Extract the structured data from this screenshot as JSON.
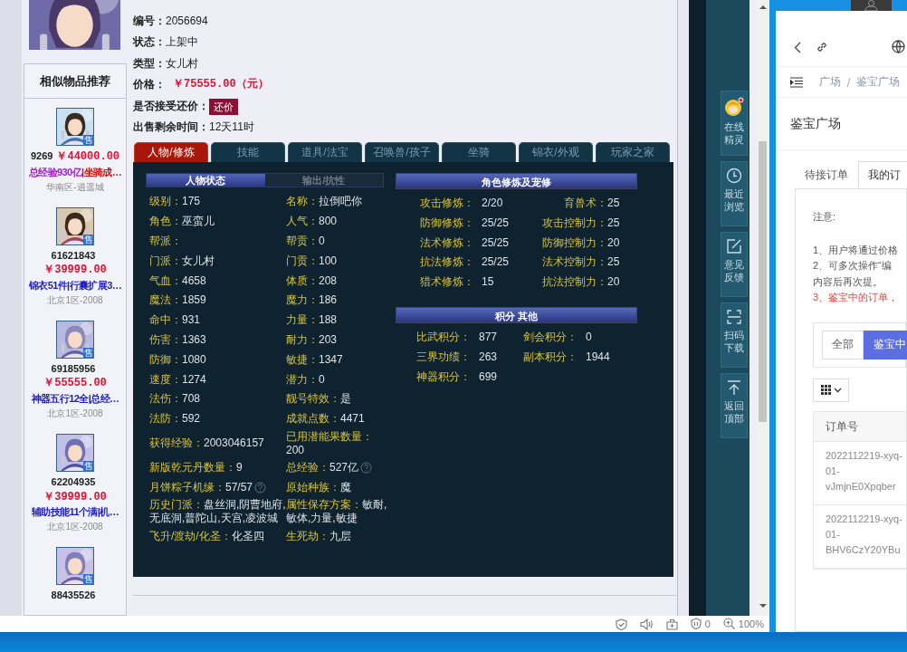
{
  "recommend": {
    "title": "相似物品推荐",
    "items": [
      {
        "badge": "售",
        "id": "9269",
        "price": "￥44000.00",
        "desc": [
          {
            "text": "总经验930亿",
            "color": "#a01ec8"
          },
          {
            "text": "|坐骑成…",
            "color": "#d01010"
          }
        ],
        "server": "华南区-逍遥城"
      },
      {
        "badge": "售",
        "id": "61621843",
        "price": "￥39999.00",
        "desc": [
          {
            "text": "锦衣51件|行囊扩展3…",
            "color": "#1e1ec8"
          }
        ],
        "server": "北京1区-2008"
      },
      {
        "badge": "售",
        "id": "69185956",
        "price": "￥55555.00",
        "desc": [
          {
            "text": "神器五行12全|总经…",
            "color": "#1e1ec8"
          }
        ],
        "server": "北京1区-2008"
      },
      {
        "badge": "售",
        "id": "62204935",
        "price": "￥39999.00",
        "desc": [
          {
            "text": "辅助技能11个满|机…",
            "color": "#1e1ec8"
          }
        ],
        "server": "北京1区-2008"
      },
      {
        "badge": "售",
        "id": "88435526"
      }
    ]
  },
  "listing": {
    "fields": [
      {
        "label": "编号：",
        "value": "2056694",
        "kind": "plain"
      },
      {
        "label": "状态：",
        "value": "上架中",
        "kind": "plain"
      },
      {
        "label": "类型：",
        "value": "女儿村",
        "kind": "plain"
      },
      {
        "label": "价格：",
        "value": "￥75555.00（元）",
        "kind": "price"
      },
      {
        "label": "是否接受还价：",
        "value": "还价",
        "kind": "button"
      },
      {
        "label": "出售剩余时间：",
        "value": "12天11时",
        "kind": "plain"
      }
    ]
  },
  "tabs": [
    {
      "label": "人物/修炼",
      "selected": true
    },
    {
      "label": "技能",
      "selected": false
    },
    {
      "label": "道具/法宝",
      "selected": false
    },
    {
      "label": "召唤兽/孩子",
      "selected": false
    },
    {
      "label": "坐骑",
      "selected": false
    },
    {
      "label": "锦衣/外观",
      "selected": false
    },
    {
      "label": "玩家之家",
      "selected": false
    }
  ],
  "status_panel": {
    "tabs": [
      {
        "label": "人物状态",
        "selected": true
      },
      {
        "label": "输出/抗性",
        "selected": false
      }
    ],
    "rows": [
      [
        {
          "label": "级别：",
          "value": "175"
        },
        {
          "label": "名称：",
          "value": "拉倒吧你"
        }
      ],
      [
        {
          "label": "角色：",
          "value": "巫蛮儿"
        },
        {
          "label": "人气：",
          "value": "800"
        }
      ],
      [
        {
          "label": "帮派："
        },
        {
          "label": "帮贡：",
          "value": "0"
        }
      ],
      [
        {
          "label": "门派：",
          "value": "女儿村"
        },
        {
          "label": "门贡：",
          "value": "100"
        }
      ],
      [
        {
          "label": "气血：",
          "value": "4658"
        },
        {
          "label": "体质：",
          "value": "208"
        }
      ],
      [
        {
          "label": "魔法：",
          "value": "1859"
        },
        {
          "label": "魔力：",
          "value": "186"
        }
      ],
      [
        {
          "label": "命中：",
          "value": "931"
        },
        {
          "label": "力量：",
          "value": "188"
        }
      ],
      [
        {
          "label": "伤害：",
          "value": "1363"
        },
        {
          "label": "耐力：",
          "value": "203"
        }
      ],
      [
        {
          "label": "防御：",
          "value": "1080"
        },
        {
          "label": "敏捷：",
          "value": "1347"
        }
      ],
      [
        {
          "label": "速度：",
          "value": "1274"
        },
        {
          "label": "潜力：",
          "value": "0"
        }
      ],
      [
        {
          "label": "法伤：",
          "value": "708"
        },
        {
          "label": "靓号特效：",
          "value": "是"
        }
      ],
      [
        {
          "label": "法防：",
          "value": "592"
        },
        {
          "label": "成就点数：",
          "value": "4471"
        }
      ],
      [
        {
          "label": "获得经验：",
          "value": "2003046157"
        },
        {
          "label": "已用潜能果数量：",
          "value": "200"
        }
      ],
      [
        {
          "label": "新版乾元丹数量：",
          "value": "9"
        },
        {
          "label": "总经验：",
          "value": "527亿",
          "help": true
        }
      ],
      [
        {
          "label": "月饼粽子机缘：",
          "value": "57/57",
          "help": true
        },
        {
          "label": "原始种族：",
          "value": "魔"
        }
      ],
      [
        {
          "label": "历史门派：",
          "value": "盘丝洞,阴曹地府,无底洞,普陀山,天宫,凌波城"
        },
        {
          "label": "属性保存方案：",
          "value": "敏耐,敏体,力量,敏捷"
        }
      ],
      [
        {
          "label": "飞升/渡劫/化圣：",
          "value": "化圣四"
        },
        {
          "label": "生死劫：",
          "value": "九层"
        }
      ]
    ]
  },
  "cultivation": {
    "title": "角色修炼及宠修",
    "rows": [
      [
        {
          "label": "攻击修炼：",
          "value": "2/20"
        },
        {
          "label": "育兽术：",
          "value": "25"
        }
      ],
      [
        {
          "label": "防御修炼：",
          "value": "25/25"
        },
        {
          "label": "攻击控制力：",
          "value": "25"
        }
      ],
      [
        {
          "label": "法术修炼：",
          "value": "25/25"
        },
        {
          "label": "防御控制力：",
          "value": "20"
        }
      ],
      [
        {
          "label": "抗法修炼：",
          "value": "25/25"
        },
        {
          "label": "法术控制力：",
          "value": "25"
        }
      ],
      [
        {
          "label": "猎术修炼：",
          "value": "15"
        },
        {
          "label": "抗法控制力：",
          "value": "20"
        }
      ]
    ]
  },
  "points": {
    "title": "积分 其他",
    "rows": [
      [
        {
          "label": "比武积分：",
          "value": "877"
        },
        {
          "label": "剑会积分：",
          "value": "0"
        }
      ],
      [
        {
          "label": "三界功绩：",
          "value": "263"
        },
        {
          "label": "副本积分：",
          "value": "1944"
        }
      ],
      [
        {
          "label": "神器积分：",
          "value": "699"
        }
      ]
    ]
  },
  "float_menu": [
    {
      "label": "在线精灵",
      "kind": "sprite"
    },
    {
      "label": "最近浏览",
      "kind": "clock"
    },
    {
      "label": "意见反馈",
      "kind": "edit"
    },
    {
      "label": "扫码下载",
      "kind": "scan"
    },
    {
      "label": "返回顶部",
      "kind": "top"
    }
  ],
  "status_bar": {
    "blocked_count": "0",
    "zoom": "100%"
  },
  "app": {
    "breadcrumb": [
      "广场",
      "鉴宝广场"
    ],
    "title": "鉴宝广场",
    "tabs": [
      {
        "label": "待接订单",
        "selected": false
      },
      {
        "label": "我的订",
        "selected": true
      }
    ],
    "notice": [
      {
        "text": "注意:",
        "kind": "plain"
      },
      {
        "text": "1、用户将通过价格",
        "kind": "plain"
      },
      {
        "text": "2、可多次操作“编",
        "kind": "plain"
      },
      {
        "text": "内容后再次提。",
        "kind": "plain"
      },
      {
        "text": "3、鉴宝中的订单，",
        "kind": "warning"
      }
    ],
    "filters": [
      {
        "label": "全部",
        "selected": false
      },
      {
        "label": "鉴宝中",
        "selected": true
      }
    ],
    "table": {
      "columns": [
        "订单号"
      ],
      "rows": [
        [
          "2022112219-xyq-01-vJmjnE0Xpqber"
        ],
        [
          "2022112219-xyq-01-BHV6CzY20YBu"
        ]
      ]
    }
  }
}
